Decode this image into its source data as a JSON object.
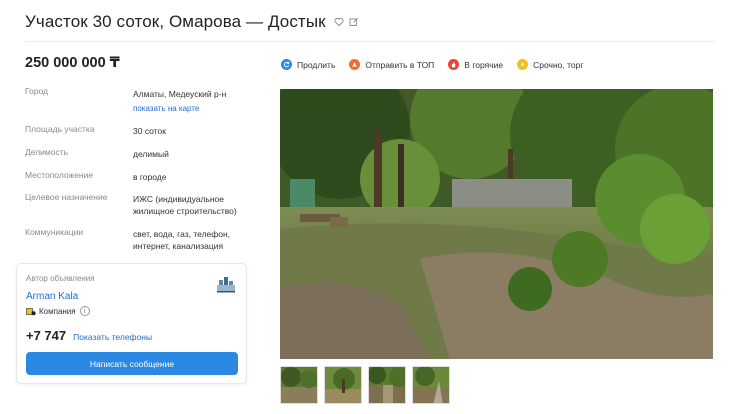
{
  "listing": {
    "title": "Участок 30 соток, Омарова — Достык",
    "price": "250 000 000",
    "currency": "₸"
  },
  "actions": [
    {
      "label": "Продлить",
      "icon": "refresh-icon",
      "color": "#2b88e3"
    },
    {
      "label": "Отправить в ТОП",
      "icon": "top-icon",
      "color": "#f26b2a"
    },
    {
      "label": "В горячие",
      "icon": "fire-icon",
      "color": "#e6453a"
    },
    {
      "label": "Срочно, торг",
      "icon": "urgent-icon",
      "color": "#f2c01e"
    }
  ],
  "params": {
    "city_label": "Город",
    "city_value": "Алматы, Медеуский р-н",
    "map_link": "показать на карте",
    "area_label": "Площадь участка",
    "area_value": "30 соток",
    "divisibility_label": "Делимость",
    "divisibility_value": "делимый",
    "location_label": "Местоположение",
    "location_value": "в городе",
    "purpose_label": "Целевое назначение",
    "purpose_value": "ИЖС (индивидуальное жилищное строительство)",
    "utilities_label": "Коммуникации",
    "utilities_value": "свет, вода, газ, телефон, интернет, канализация"
  },
  "author": {
    "label": "Автор объявления",
    "name": "Arman Kala",
    "type": "Компания",
    "info_glyph": "i",
    "phone": "+7 747",
    "phone_link": "Показать телефоны",
    "message_button": "Написать сообщение"
  },
  "colors": {
    "accent": "#2b88e3",
    "link": "#1f6fd1"
  }
}
